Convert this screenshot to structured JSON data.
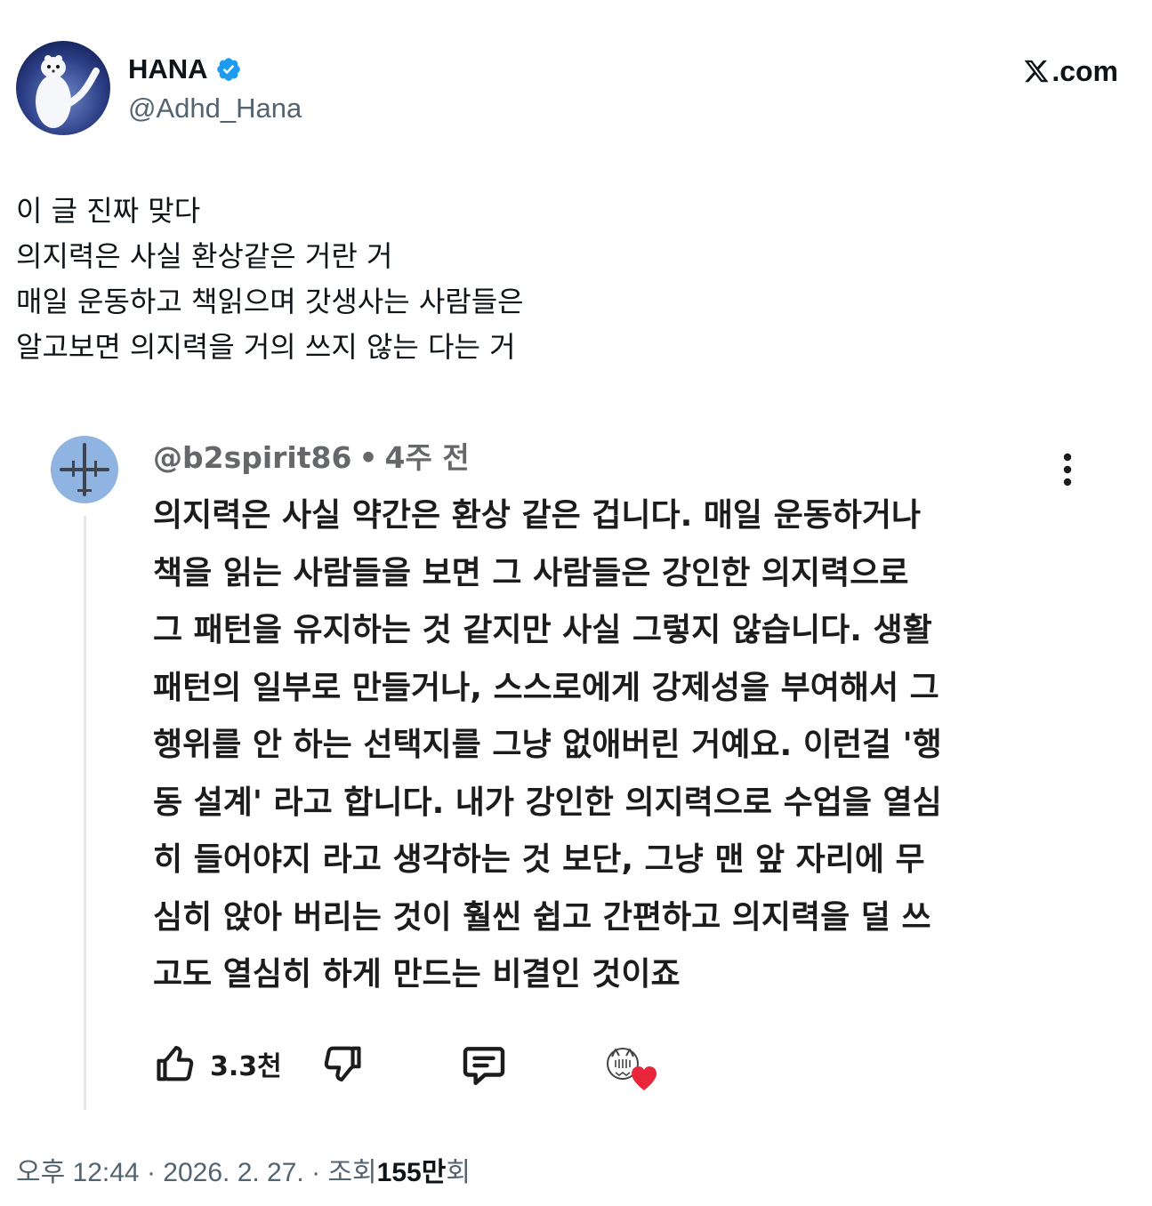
{
  "author": {
    "display_name": "HANA",
    "handle": "@Adhd_Hana",
    "verified": true,
    "verified_color": "#1d9bf0",
    "avatar_icon": "white-ermine-avatar"
  },
  "brand": {
    "label": ".com",
    "icon": "x-logo-icon"
  },
  "tweet": {
    "lines": [
      "이 글 진짜 맞다",
      "의지력은 사실 환상같은 거란 거",
      "매일 운동하고 책읽으며 갓생사는 사람들은",
      "알고보면 의지력을 거의 쓰지 않는 다는 거"
    ]
  },
  "comment": {
    "handle": "@b2spirit86",
    "separator": "•",
    "time": "4주 전",
    "avatar_icon": "airplane-avatar",
    "lines": [
      "의지력은 사실 약간은 환상 같은 겁니다. 매일 운동하거나",
      "책을 읽는 사람들을 보면 그 사람들은 강인한 의지력으로",
      "그 패턴을 유지하는 것 같지만 사실 그렇지 않습니다. 생활",
      "패턴의 일부로 만들거나, 스스로에게 강제성을 부여해서 그",
      "행위를 안 하는 선택지를 그냥 없애버린 거예요. 이런걸 '행",
      "동 설계' 라고 합니다. 내가 강인한 의지력으로 수업을 열심",
      "히 들어야지 라고 생각하는 것 보단, 그냥 맨 앞 자리에 무",
      "심히 앉아 버리는 것이 훨씬 쉽고 간편하고 의지력을 덜 쓰",
      "고도 열심히 하게 만드는 비결인 것이죠"
    ],
    "like_count": "3.3천",
    "heart_color": "#e8253b"
  },
  "footer": {
    "time": "오후 12:44",
    "separator": "·",
    "date": "2026. 2. 27.",
    "views_label": "조회",
    "views_count": "155만",
    "views_unit": "회"
  }
}
